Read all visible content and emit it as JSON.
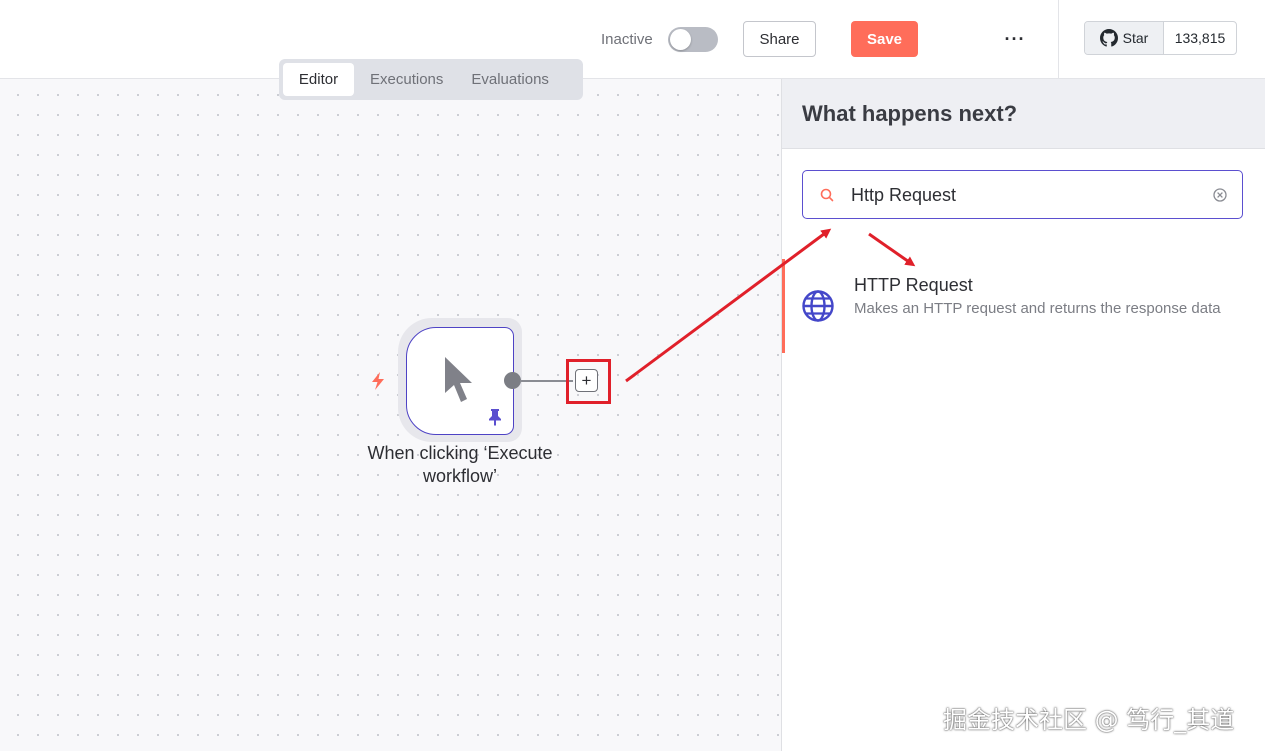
{
  "header": {
    "active_label": "Inactive",
    "active_state": false,
    "share_label": "Share",
    "save_label": "Save",
    "more_label": "···",
    "github": {
      "star_label": "Star",
      "star_count": "133,815"
    }
  },
  "tabs": [
    {
      "label": "Editor",
      "active": true
    },
    {
      "label": "Executions",
      "active": false
    },
    {
      "label": "Evaluations",
      "active": false
    }
  ],
  "canvas": {
    "node": {
      "label": "When clicking ‘Execute workflow’",
      "icon": "cursor-icon",
      "trigger_icon": "lightning-bolt-icon",
      "pinned_icon": "pin-icon"
    },
    "add_button_label": "+"
  },
  "panel": {
    "title": "What happens next?",
    "search": {
      "value": "Http Request"
    },
    "results": [
      {
        "title": "HTTP Request",
        "description": "Makes an HTTP request and returns the response data",
        "icon": "globe-icon"
      }
    ]
  },
  "watermark": "掘金技术社区 @ 笃行_其道",
  "colors": {
    "accent": "#ff6d5a",
    "node_border": "#4e43c5",
    "annotation": "#e0202a"
  }
}
